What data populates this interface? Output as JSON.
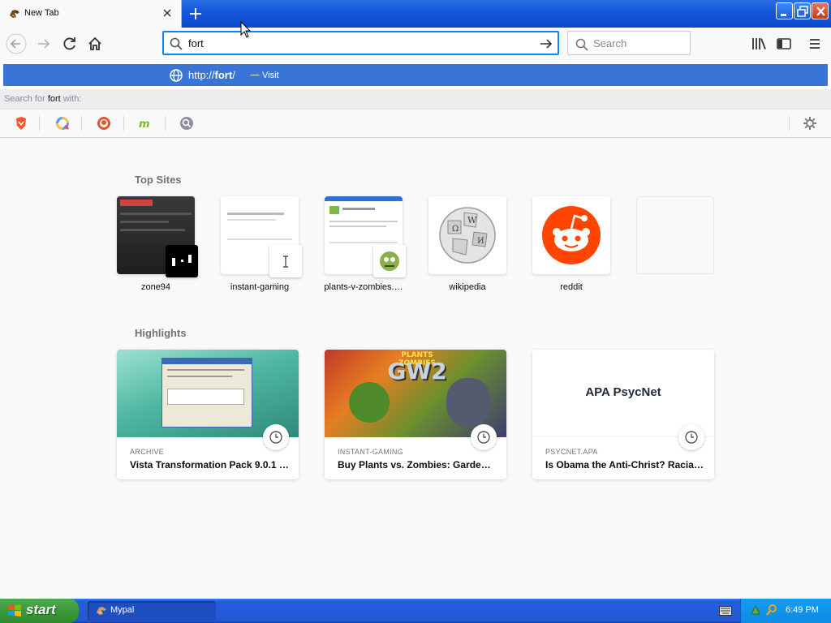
{
  "browser": {
    "tab": {
      "title": "New Tab"
    },
    "url_input": {
      "value": "fort"
    },
    "search_box": {
      "placeholder": "Search"
    }
  },
  "popup": {
    "visit_url_prefix": "http://",
    "visit_url_bold": "fort",
    "visit_url_suffix": "/",
    "visit_sep": "—",
    "visit_action": "Visit",
    "search_for_prefix": "Search for ",
    "search_for_query": "fort",
    "search_for_suffix": " with:",
    "engines": [
      "brave-engine",
      "qwant-engine",
      "duckduckgo-engine",
      "mojeek-engine",
      "other-search-engine"
    ]
  },
  "newtab": {
    "top_sites_heading": "Top Sites",
    "top_sites": [
      {
        "label": "zone94"
      },
      {
        "label": "instant-gaming"
      },
      {
        "label": "plants-v-zombies.…"
      },
      {
        "label": "wikipedia"
      },
      {
        "label": "reddit"
      },
      {
        "label": ""
      }
    ],
    "highlights_heading": "Highlights",
    "highlights": [
      {
        "source": "ARCHIVE",
        "title": "Vista Transformation Pack 9.0.1 :…"
      },
      {
        "source": "INSTANT-GAMING",
        "title": "Buy Plants vs. Zombies: Garden …"
      },
      {
        "source": "PSYCNET.APA",
        "title": "Is Obama the Anti-Christ? Racial …",
        "thumb_text": "APA PsycNet"
      }
    ],
    "pvz_logo_top": "PLANTS ZOMBIES",
    "pvz_logo_main": "GW2"
  },
  "taskbar": {
    "start_label": "start",
    "task_label": "Mypal",
    "clock": "6:49 PM"
  },
  "colors": {
    "accent_blue": "#3875d6",
    "focus_blue": "#0a84ff",
    "reddit_orange": "#ff4500",
    "xp_start_green": "#3c9a3a"
  }
}
